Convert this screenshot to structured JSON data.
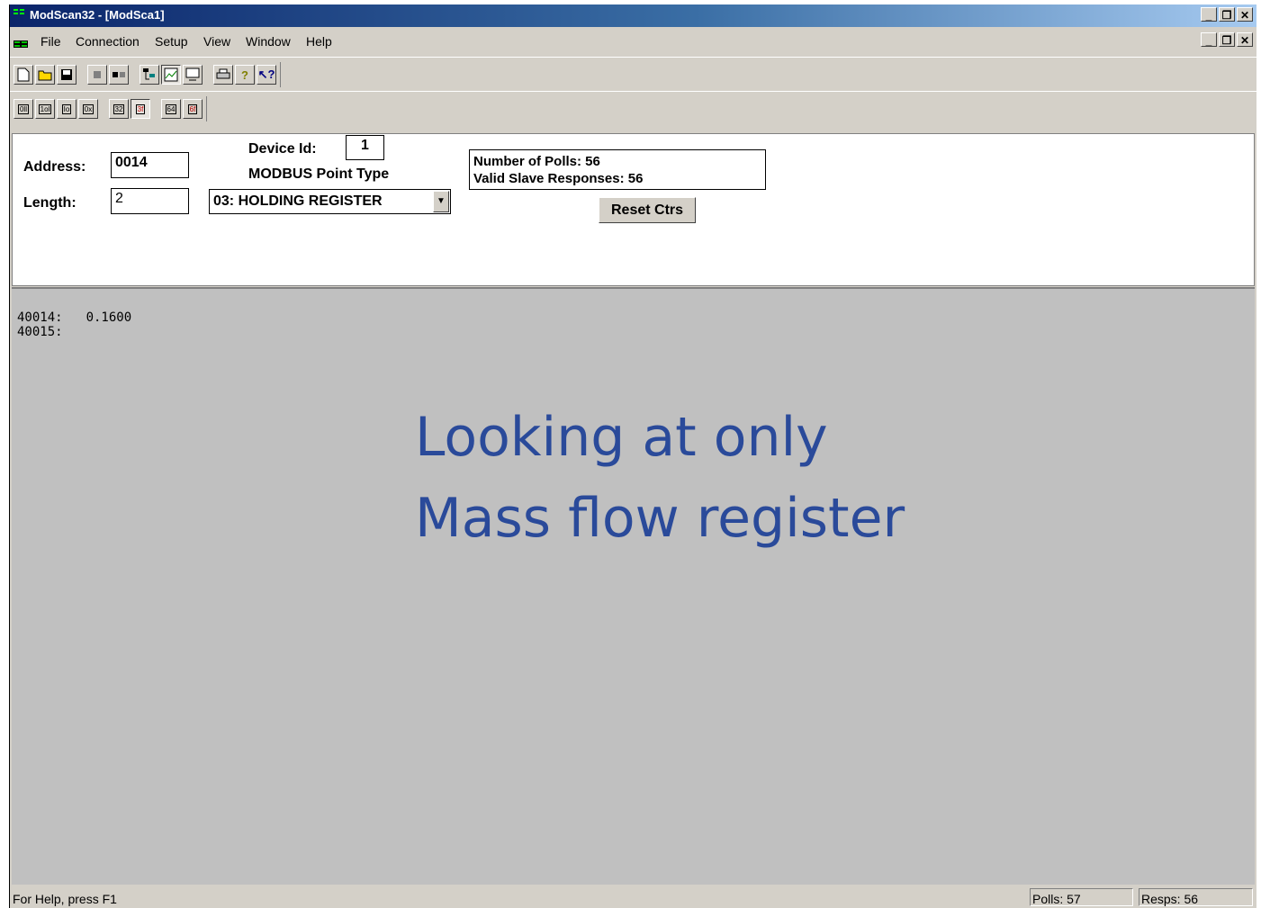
{
  "window": {
    "title": "ModScan32 - [ModSca1]"
  },
  "menu": {
    "items": [
      "File",
      "Connection",
      "Setup",
      "View",
      "Window",
      "Help"
    ]
  },
  "window_buttons": {
    "minimize": "_",
    "restore": "❐",
    "close": "✕"
  },
  "toolbar1": [
    "new",
    "open",
    "save",
    "connect",
    "disconnect",
    "display-options",
    "trend",
    "monitor",
    "print",
    "about",
    "context-help"
  ],
  "toolbar2": [
    "0ll",
    "1ol",
    "Io",
    "0x",
    "32",
    "3f",
    "64",
    "6f"
  ],
  "form": {
    "address_label": "Address:",
    "address_value": "0014",
    "length_label": "Length:",
    "length_value": "2",
    "device_id_label": "Device Id:",
    "device_id_value": "1",
    "point_type_label": "MODBUS Point Type",
    "point_type_value": "03: HOLDING REGISTER",
    "polls_text": "Number of Polls: 56",
    "responses_text": "Valid Slave Responses: 56",
    "reset_label": "Reset Ctrs"
  },
  "registers": [
    {
      "address": "40014:",
      "value": "0.1600"
    },
    {
      "address": "40015:",
      "value": ""
    }
  ],
  "annotation": {
    "line1": "Looking at only",
    "line2": "Mass flow register"
  },
  "status": {
    "help": "For Help, press F1",
    "polls": "Polls: 57",
    "resps": "Resps: 56"
  }
}
